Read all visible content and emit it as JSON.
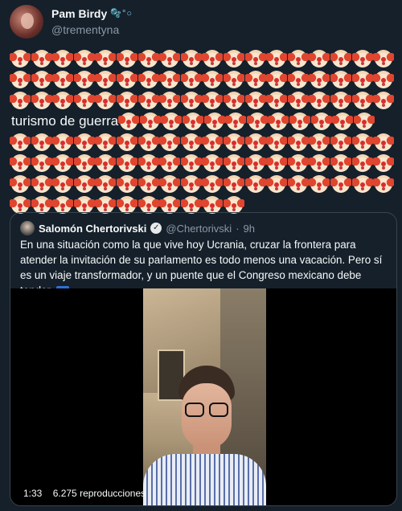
{
  "tweet": {
    "author": {
      "display_name": "Pam Birdy",
      "name_decoration": "🫧°○",
      "handle": "@trementyna"
    },
    "emoji": "clown-face",
    "inline_text": "turismo de guerra",
    "rows": [
      {
        "before": 18,
        "text": false,
        "after": 0
      },
      {
        "before": 18,
        "text": false,
        "after": 0
      },
      {
        "before": 18,
        "text": false,
        "after": 0
      },
      {
        "before": 0,
        "text": true,
        "after": 12
      },
      {
        "before": 18,
        "text": false,
        "after": 0
      },
      {
        "before": 18,
        "text": false,
        "after": 0
      },
      {
        "before": 18,
        "text": false,
        "after": 0
      },
      {
        "before": 11,
        "text": false,
        "after": 0
      }
    ]
  },
  "quoted": {
    "author_name": "Salomón Chertorivski",
    "verified": true,
    "handle": "@Chertorivski",
    "separator": "·",
    "time": "9h",
    "text": "En una situación como la que vive hoy Ucrania, cruzar la frontera para atender la invitación de su parlamento es todo menos una vacación. Pero sí es un viaje transformador, y un puente que el Congreso mexicano debe tender.",
    "trailing_emoji": "ukraine-flag",
    "video": {
      "duration": "1:33",
      "views": "6.275 reproducciones"
    }
  }
}
